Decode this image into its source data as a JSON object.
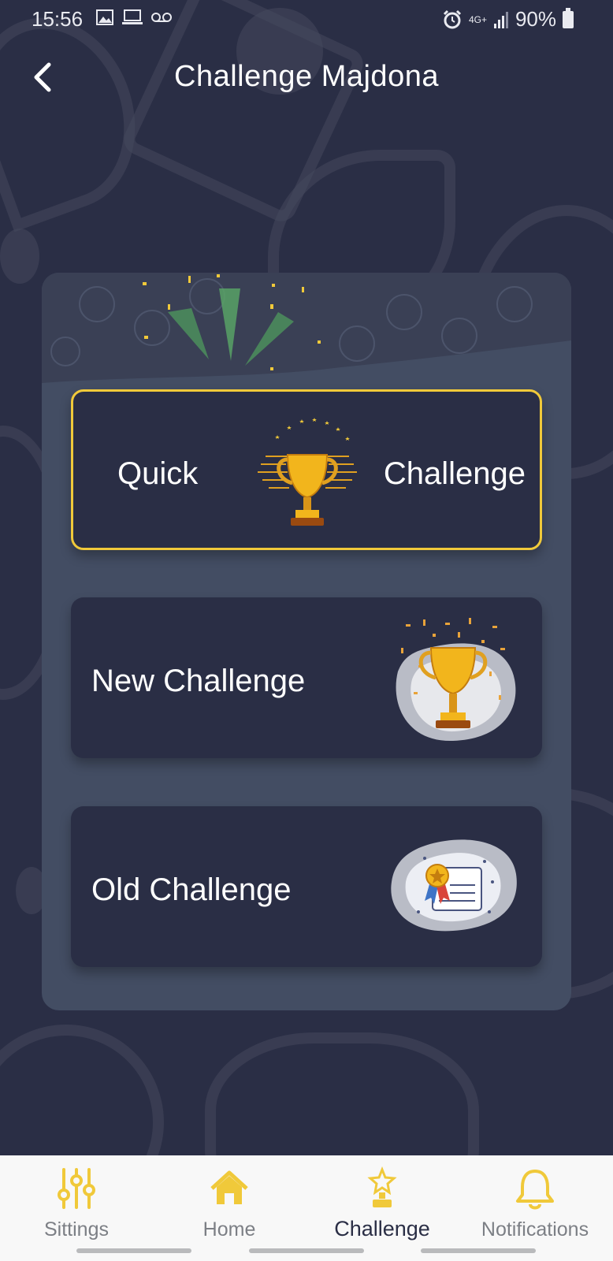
{
  "status_bar": {
    "time": "15:56",
    "network": "4G+",
    "battery": "90%",
    "icons": [
      "image-icon",
      "laptop-icon",
      "voicemail-icon",
      "alarm-icon",
      "signal-icon",
      "battery-icon"
    ]
  },
  "header": {
    "title": "Challenge Majdona",
    "back_icon": "chevron-left-icon"
  },
  "cards": {
    "quick": {
      "label_left": "Quick",
      "label_right": "Challenge",
      "icon": "trophy-icon"
    },
    "new": {
      "label": "New Challenge",
      "icon": "trophy-confetti-icon"
    },
    "old": {
      "label": "Old Challenge",
      "icon": "certificate-icon"
    }
  },
  "nav": {
    "items": [
      {
        "label": "Sittings",
        "icon": "sliders-icon"
      },
      {
        "label": "Home",
        "icon": "home-icon"
      },
      {
        "label": "Challenge",
        "icon": "star-trophy-icon"
      },
      {
        "label": "Notifications",
        "icon": "bell-icon"
      }
    ],
    "active_index": 2
  },
  "colors": {
    "background": "#2a2e45",
    "panel": "#434d63",
    "accent": "#f0c93a",
    "nav_background": "#f8f8f8"
  }
}
